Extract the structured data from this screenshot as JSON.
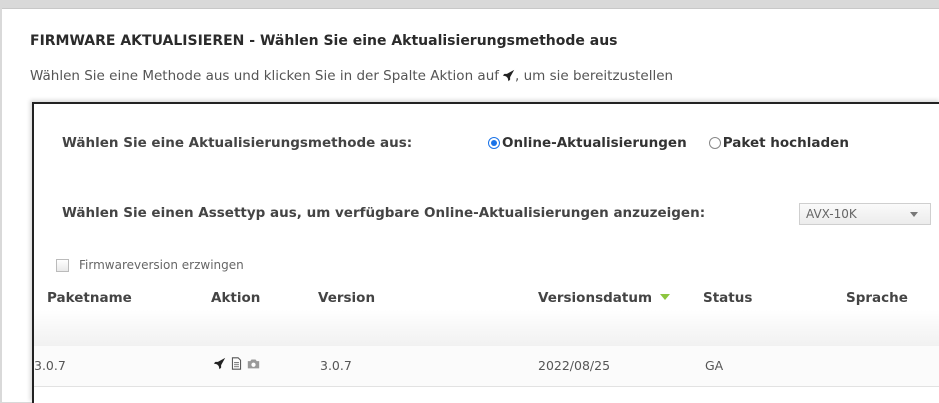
{
  "header": {
    "title": "FIRMWARE AKTUALISIEREN - Wählen Sie eine Aktualisierungsmethode aus",
    "subtitle_before": "Wählen Sie eine Methode aus und klicken Sie in der Spalte Aktion auf",
    "subtitle_after": ", um sie bereitzustellen"
  },
  "method": {
    "label": "Wählen Sie eine Aktualisierungsmethode aus:",
    "options": [
      {
        "label": "Online-Aktualisierungen",
        "selected": true
      },
      {
        "label": "Paket hochladen",
        "selected": false
      }
    ]
  },
  "asset": {
    "label": "Wählen Sie einen Assettyp aus, um verfügbare Online-Aktualisierungen anzuzeigen:",
    "selected": "AVX-10K"
  },
  "force": {
    "label": "Firmwareversion erzwingen",
    "checked": false
  },
  "table": {
    "columns": [
      "Paketname",
      "Aktion",
      "Version",
      "Versionsdatum",
      "Status",
      "Sprache"
    ],
    "sort_column": "Versionsdatum",
    "rows": [
      {
        "package": "3.0.7",
        "actions": [
          "rocket-icon",
          "document-icon",
          "camera-icon"
        ],
        "version": "3.0.7",
        "date": "2022/08/25",
        "status": "GA",
        "language": ""
      }
    ]
  },
  "colors": {
    "accent_radio": "#1a73e8",
    "sort_icon": "#8dc63f"
  }
}
